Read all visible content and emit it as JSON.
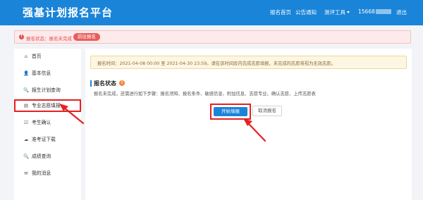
{
  "header": {
    "title": "强基计划报名平台",
    "nav": {
      "home": "报名首页",
      "notice": "公告通知",
      "tools": "测评工具",
      "user": "15668",
      "logout": "退出"
    }
  },
  "status": {
    "icon": "!",
    "text": "报名状态：报名未完成",
    "button": "前往报名"
  },
  "sidebar": {
    "items": [
      {
        "icon": "⌂",
        "label": "首页"
      },
      {
        "icon": "👤",
        "label": "基本信息"
      },
      {
        "icon": "🔍",
        "label": "报生计划查询"
      },
      {
        "icon": "▤",
        "label": "专业志愿填报"
      },
      {
        "icon": "☑",
        "label": "考生确认"
      },
      {
        "icon": "☁",
        "label": "准考证下载"
      },
      {
        "icon": "🔍",
        "label": "成绩查询"
      },
      {
        "icon": "✉",
        "label": "我的消息"
      }
    ]
  },
  "main": {
    "notice": "报名时间：2021-04-08 00:00 至 2021-04-30 23:59。请在该时间段内完成志愿填报，未完成的志愿将视为无效志愿。",
    "section_title": "报名状态",
    "section_badge": "!",
    "description": "报名未完成，还需进行如下步骤：报名须知、报名条件、敏感信息、附加信息、志愿专业、确认志愿、上传志愿表",
    "start_button": "开始填报",
    "cancel_button": "取消报名"
  },
  "colors": {
    "header": "#1a84d8",
    "annotation": "#e62020",
    "status_red": "#e84b4b",
    "notice_bg": "#fdf6e3"
  }
}
